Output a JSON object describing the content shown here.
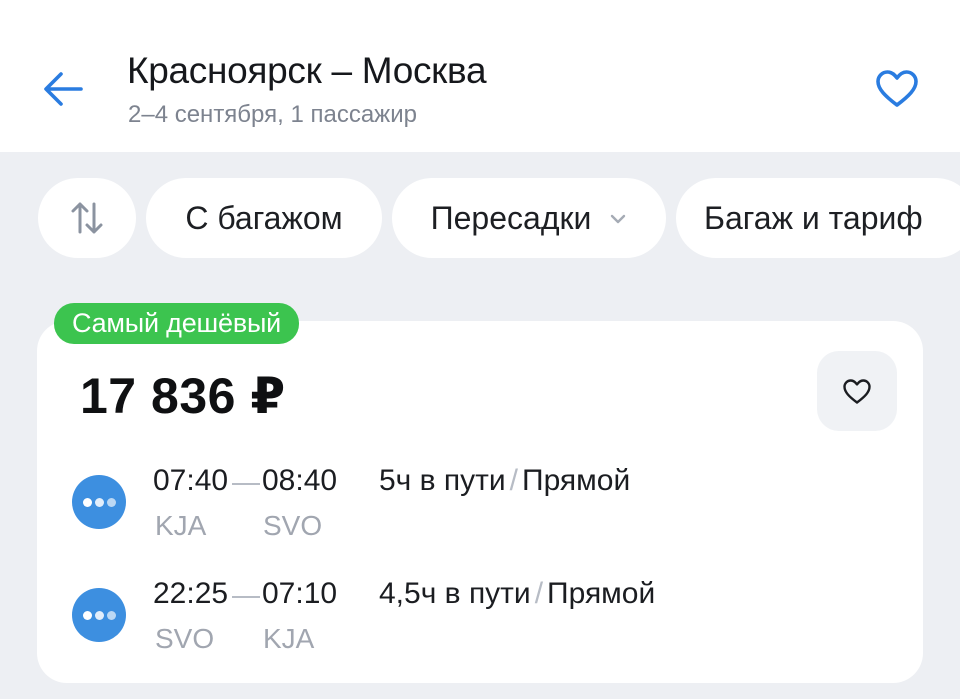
{
  "header": {
    "route_title": "Красноярск – Москва",
    "route_subtitle": "2–4 сентября, 1 пассажир",
    "back_icon": "arrow-left-icon",
    "favorite_icon": "heart-icon",
    "accent_color": "#2a7ce0"
  },
  "filters": {
    "sort_icon": "sort-arrows-icon",
    "chips": [
      {
        "label": "С багажом"
      },
      {
        "label": "Пересадки",
        "icon": "chevron-down-icon"
      },
      {
        "label": "Багаж и тариф"
      }
    ]
  },
  "ticket": {
    "badge": "Самый дешёвый",
    "badge_color": "#3cc44f",
    "price": "17 836 ₽",
    "favorite_icon": "heart-icon",
    "segments": [
      {
        "dep_time": "07:40",
        "arr_time": "08:40",
        "dep_code": "KJA",
        "arr_code": "SVO",
        "duration": "5ч в пути",
        "separator": "/",
        "stops": "Прямой",
        "airline_icon": "airline-logo-icon"
      },
      {
        "dep_time": "22:25",
        "arr_time": "07:10",
        "dep_code": "SVO",
        "arr_code": "KJA",
        "duration": "4,5ч в пути",
        "separator": "/",
        "stops": "Прямой",
        "airline_icon": "airline-logo-icon"
      }
    ]
  }
}
